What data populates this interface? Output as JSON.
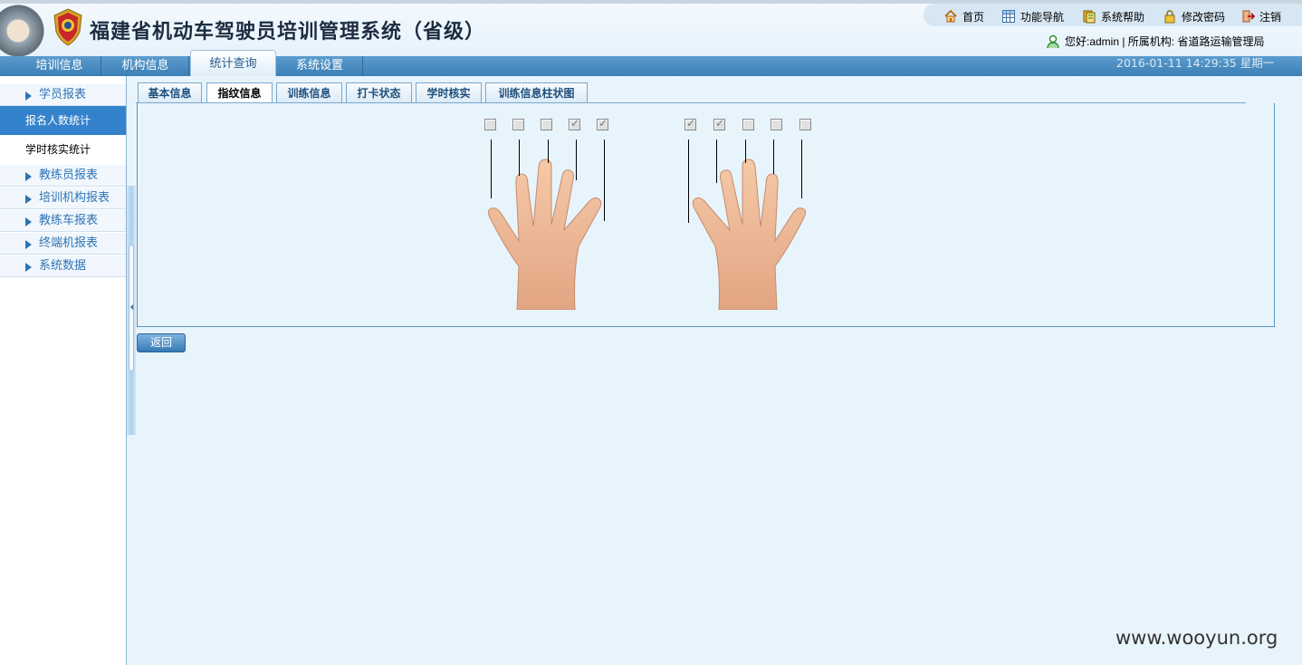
{
  "app": {
    "title": "福建省机动车驾驶员培训管理系统（省级）"
  },
  "toplinks": [
    {
      "label": "首页",
      "icon": "home-icon"
    },
    {
      "label": "功能导航",
      "icon": "grid-icon"
    },
    {
      "label": "系统帮助",
      "icon": "help-book-icon"
    },
    {
      "label": "修改密码",
      "icon": "lock-icon"
    },
    {
      "label": "注销",
      "icon": "logout-icon"
    }
  ],
  "user": {
    "greeting": "您好:admin | 所属机构: 省道路运输管理局"
  },
  "nav": {
    "tabs": [
      "培训信息",
      "机构信息",
      "统计查询",
      "系统设置"
    ],
    "active": "统计查询",
    "datetime": "2016-01-11 14:29:35 星期一"
  },
  "sidebar": {
    "group1": "学员报表",
    "sub1": "报名人数统计",
    "sub2": "学时核实统计",
    "group2": "教练员报表",
    "group3": "培训机构报表",
    "group4": "教练车报表",
    "group5": "终端机报表",
    "group6": "系统数据"
  },
  "content_tabs": [
    "基本信息",
    "指纹信息",
    "训练信息",
    "打卡状态",
    "学时核实",
    "训练信息柱状图"
  ],
  "active_content_tab": "指纹信息",
  "fingerprints": {
    "left_hand": [
      false,
      false,
      false,
      true,
      true
    ],
    "right_hand": [
      true,
      true,
      false,
      false,
      false
    ]
  },
  "back_button": "返回",
  "watermark": "www.wooyun.org",
  "colors": {
    "nav_blue": "#3c7fb6",
    "sidebar_selected": "#3582cc",
    "link_blue": "#2e74b5",
    "page_bg": "#e8f4fc"
  }
}
